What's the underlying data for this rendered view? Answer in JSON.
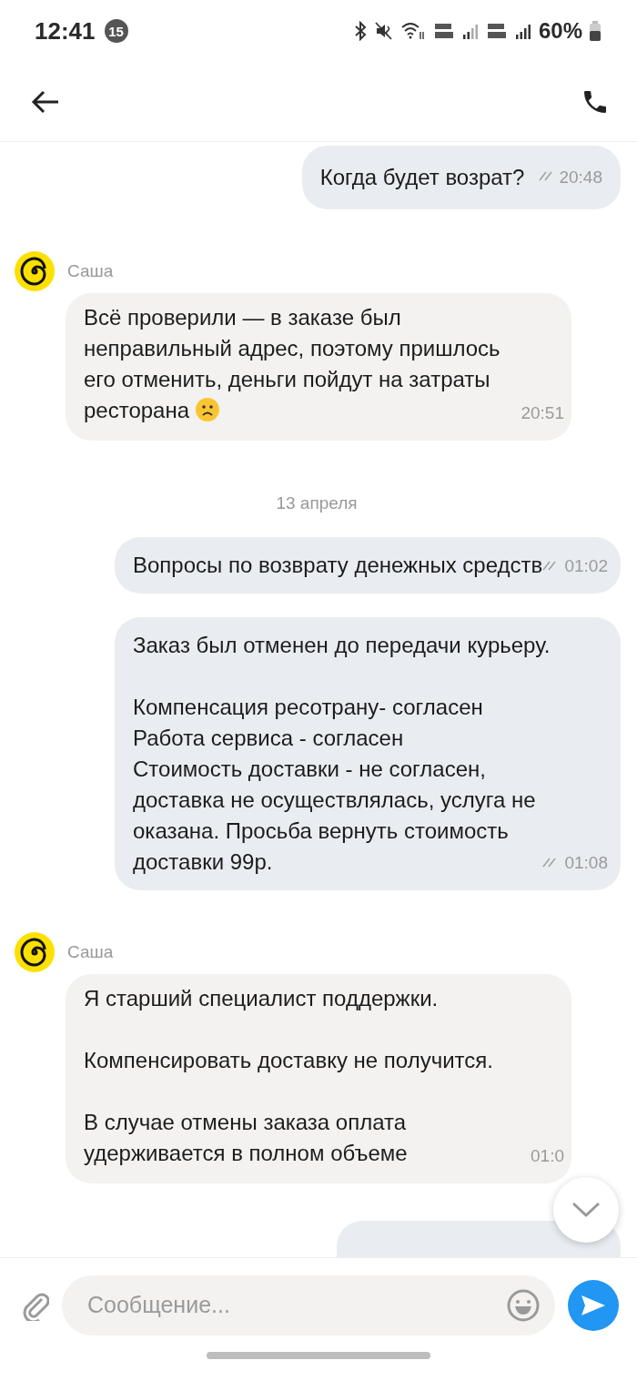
{
  "status_bar": {
    "time": "12:41",
    "notification_count": "15",
    "battery": "60%"
  },
  "messages": [
    {
      "kind": "outgoing",
      "paragraphs": [
        "Когда будет возрат?"
      ],
      "time": "20:48",
      "read": true
    },
    {
      "kind": "incoming",
      "sender": "Саша",
      "paragraphs": [
        "Всё проверили — в заказе был неправильный адрес, поэтому пришлось его отменить, деньги пойдут на затраты ресторана"
      ],
      "trailing_icon": {
        "kind": "sad_face"
      },
      "time": "20:51"
    },
    {
      "kind": "date",
      "label": "13 апреля"
    },
    {
      "kind": "outgoing",
      "paragraphs": [
        "Вопросы по возврату денежных средств"
      ],
      "time": "01:02",
      "read": true
    },
    {
      "kind": "outgoing",
      "paragraphs": [
        "Заказ был отменен до передачи курьеру.",
        "Компенсация ресотрану- согласен\nРабота сервиса - согласен\nСтоимость доставки - не согласен, доставка не осуществлялась, услуга не оказана. Просьба вернуть стоимость доставки 99р."
      ],
      "time": "01:08",
      "read": true
    },
    {
      "kind": "incoming",
      "sender": "Саша",
      "paragraphs": [
        "Я старший специалист поддержки.",
        "Компенсировать доставку не получится.",
        "В случае отмены заказа оплата удерживается в полном объеме"
      ],
      "time": "01:0"
    },
    {
      "kind": "outgoing_peek"
    }
  ],
  "composer": {
    "placeholder": "Сообщение..."
  }
}
